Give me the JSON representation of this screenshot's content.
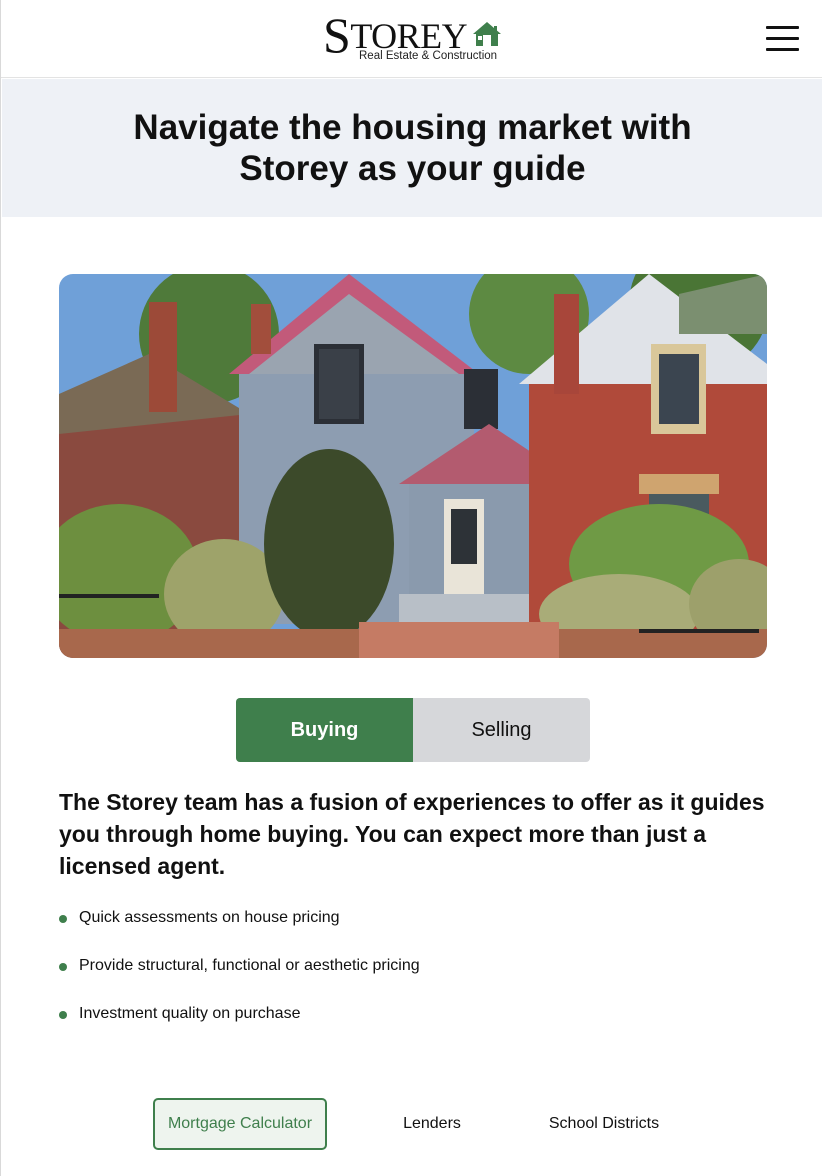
{
  "brand": {
    "logo_main": "TOREY",
    "logo_initial": "S",
    "logo_sub": "Real Estate & Construction",
    "accent_color": "#3f7f4c"
  },
  "header": {
    "menu_icon": "hamburger-menu-icon"
  },
  "hero": {
    "title": "Navigate the housing market with Storey as your guide"
  },
  "tabs": [
    {
      "label": "Buying",
      "active": true
    },
    {
      "label": "Selling",
      "active": false
    }
  ],
  "content": {
    "lead": "The Storey team has a fusion of experiences to offer as it guides you through home buying. You can expect more than just a licensed agent.",
    "bullets": [
      "Quick assessments on house pricing",
      "Provide structural, functional or aesthetic pricing",
      "Investment quality on purchase"
    ]
  },
  "bottom_links": [
    {
      "label": "Mortgage Calculator",
      "active": true
    },
    {
      "label": "Lenders",
      "active": false
    },
    {
      "label": "School Districts",
      "active": false
    }
  ]
}
